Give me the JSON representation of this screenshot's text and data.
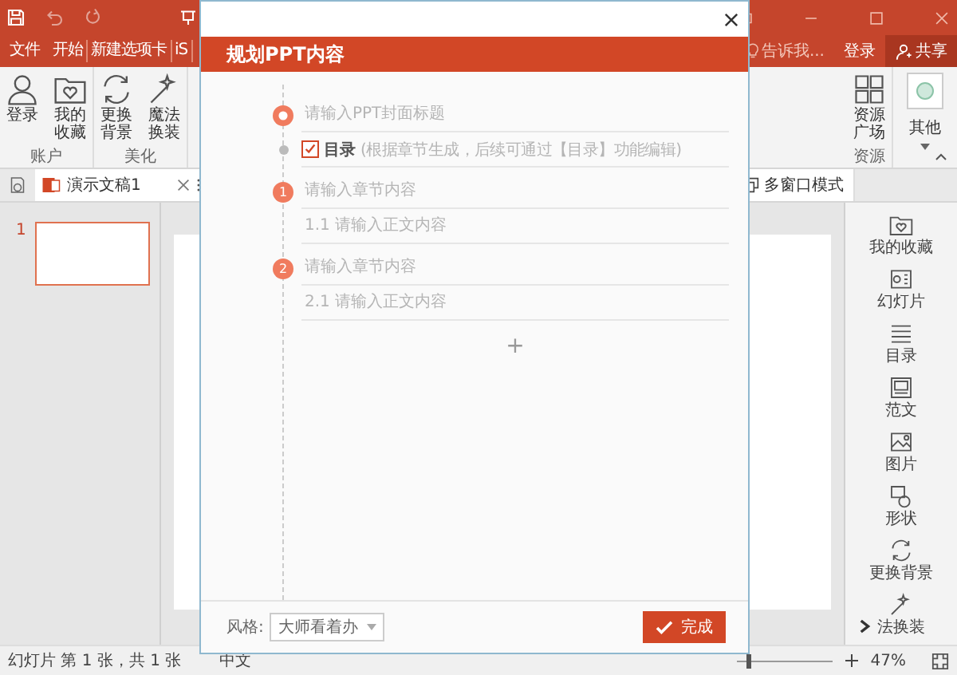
{
  "ribbon_tabs": [
    "文件",
    "开始",
    "新建选项卡",
    "iS"
  ],
  "ribbon_right": {
    "tell_me": "告诉我...",
    "login": "登录",
    "share": "共享"
  },
  "ribbon_groups": [
    {
      "label": "账户",
      "buttons": [
        "登录",
        "我的收藏"
      ]
    },
    {
      "label": "美化",
      "buttons": [
        "更换背景",
        "魔法换装"
      ]
    }
  ],
  "ribbon_groups_right": [
    {
      "label": "资源",
      "buttons": [
        "资源广场"
      ]
    },
    {
      "buttons": [
        "其他"
      ]
    }
  ],
  "document_tab": {
    "title": "演示文稿1"
  },
  "multi_window": "多窗口模式",
  "thumbnails": [
    {
      "number": "1",
      "selected": true
    }
  ],
  "side_panel": [
    "我的收藏",
    "幻灯片",
    "目录",
    "范文",
    "图片",
    "形状",
    "更换背景",
    "法换装"
  ],
  "status_bar": {
    "slide_info": "幻灯片 第 1 张，共 1 张",
    "language": "中文",
    "zoom": {
      "level": 0.1,
      "reading": "47%"
    }
  },
  "dialog": {
    "title": "规划PPT内容",
    "outline": [
      {
        "kind": "cover",
        "placeholder": "请输入PPT封面标题"
      },
      {
        "kind": "toc",
        "checked": true,
        "label": "目录",
        "note": "(根据章节生成，后续可通过【目录】功能编辑)"
      },
      {
        "kind": "chapter",
        "number": "1",
        "placeholder": "请输入章节内容"
      },
      {
        "kind": "section",
        "placeholder": "1.1 请输入正文内容"
      },
      {
        "kind": "chapter",
        "number": "2",
        "placeholder": "请输入章节内容"
      },
      {
        "kind": "section",
        "placeholder": "2.1 请输入正文内容"
      }
    ],
    "add": "+",
    "style_label": "风格:",
    "style_value": "大师看着办",
    "done": "完成"
  }
}
